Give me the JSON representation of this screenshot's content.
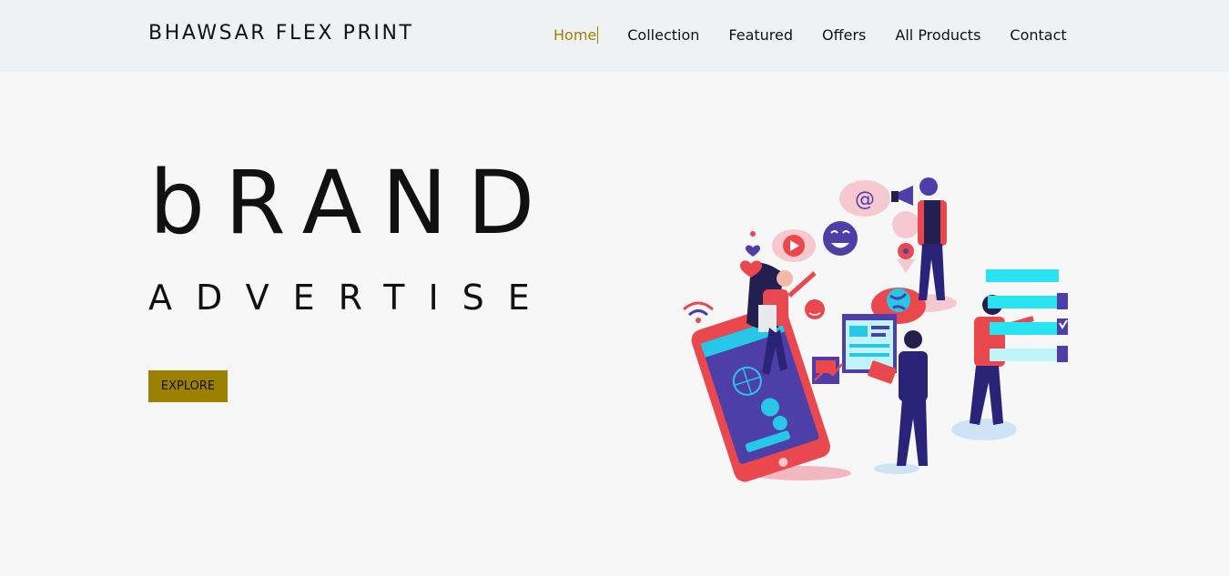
{
  "header": {
    "brand": "BHAWSAR FLEX PRINT",
    "nav": [
      {
        "label": "Home",
        "active": true
      },
      {
        "label": "Collection"
      },
      {
        "label": "Featured"
      },
      {
        "label": "Offers"
      },
      {
        "label": "All Products"
      },
      {
        "label": "Contact"
      }
    ]
  },
  "hero": {
    "title": "bRAND",
    "subtitle": "ADVERTISE",
    "button_label": "EXPLORE"
  },
  "colors": {
    "accent": "#9c8100",
    "navbar_bg": "#f0f1f3",
    "page_bg": "#f7f7f7"
  }
}
